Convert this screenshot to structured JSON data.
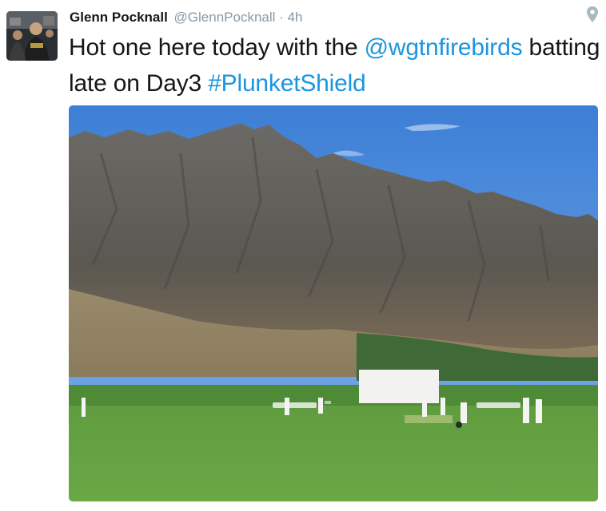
{
  "tweet": {
    "display_name": "Glenn Pocknall",
    "handle": "@GlennPocknall",
    "separator": "·",
    "time": "4h",
    "text_part1": "Hot one here today with the ",
    "mention": "@wgtnfirebirds",
    "text_part2": " batting late on Day3 ",
    "hashtag": "#PlunketShield"
  },
  "icons": {
    "location": "location-pin-icon"
  },
  "colors": {
    "link": "#1b95e0",
    "text": "#14171a",
    "secondary": "#8899a6"
  }
}
